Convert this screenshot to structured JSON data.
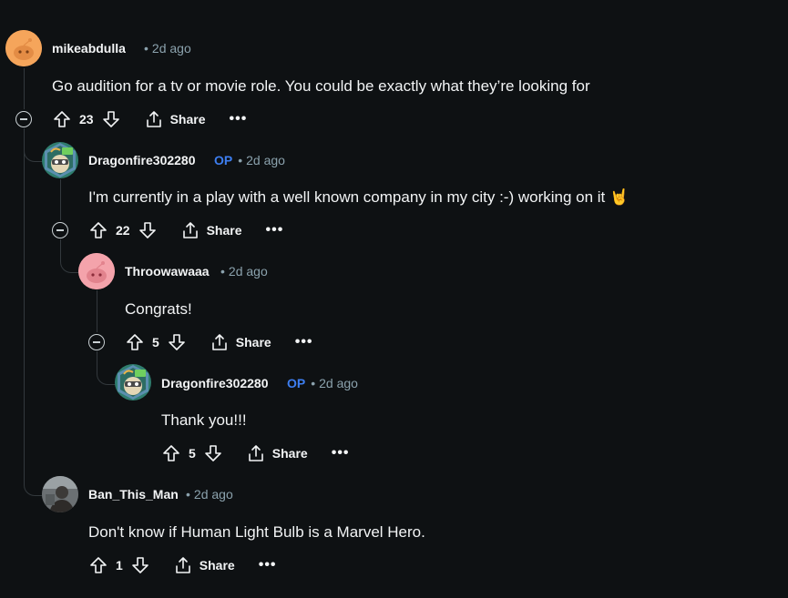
{
  "comments": [
    {
      "author": "mikeabdulla",
      "op": "",
      "time": "2d ago",
      "body": "Go audition for a tv or movie role. You could be exactly what they’re looking for",
      "votes": "23",
      "share": "Share",
      "more": "•••",
      "avatar": "orange-snoo-avatar"
    },
    {
      "author": "Dragonfire302280",
      "op": "OP",
      "time": "2d ago",
      "body": "I'm currently in a play with a well known company in my city :-) working on it ",
      "emoji": "🤘",
      "votes": "22",
      "share": "Share",
      "more": "•••",
      "avatar": "cartoon-character-avatar"
    },
    {
      "author": "Throowawaaa",
      "op": "",
      "time": "2d ago",
      "body": "Congrats!",
      "votes": "5",
      "share": "Share",
      "more": "•••",
      "avatar": "pink-snoo-avatar"
    },
    {
      "author": "Dragonfire302280",
      "op": "OP",
      "time": "2d ago",
      "body": "Thank you!!!",
      "votes": "5",
      "share": "Share",
      "more": "•••",
      "avatar": "cartoon-character-avatar"
    },
    {
      "author": "Ban_This_Man",
      "op": "",
      "time": "2d ago",
      "body": "Don't know if Human Light Bulb is a Marvel Hero.",
      "votes": "1",
      "share": "Share",
      "more": "•••",
      "avatar": "photo-avatar"
    }
  ],
  "colors": {
    "background": "#0e1113",
    "text": "#f2f4f5",
    "meta": "#8ba2ad",
    "op": "#3d7ef0",
    "thread_line": "#33393d"
  }
}
